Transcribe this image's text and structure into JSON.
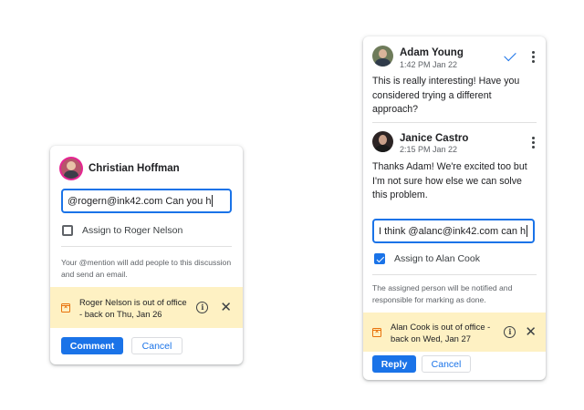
{
  "left_card": {
    "user_name": "Christian Hoffman",
    "input_value": "@rogern@ink42.com Can you h",
    "assign_label": "Assign to Roger Nelson",
    "assign_checked": false,
    "hint": "Your @mention will add people to this discussion and send an email.",
    "banner_text": "Roger Nelson is out of office - back on Thu, Jan 26",
    "primary_button": "Comment",
    "secondary_button": "Cancel",
    "banner_icon": "calendar-out-of-office-icon",
    "info_icon": "info-icon",
    "close_icon": "close-icon"
  },
  "right_card": {
    "comment1": {
      "author": "Adam Young",
      "time": "1:42 PM Jan 22",
      "text": "This is really interesting! Have you considered trying a different approach?"
    },
    "comment2": {
      "author": "Janice Castro",
      "time": "2:15 PM Jan 22",
      "text": "Thanks Adam! We're excited too but I'm not sure how else we can solve this problem."
    },
    "input_value": "I think @alanc@ink42.com can h",
    "assign_label": "Assign to Alan Cook",
    "assign_checked": true,
    "hint": "The assigned person will be notified and responsible for marking as done.",
    "banner_text": "Alan Cook is out of office - back on Wed, Jan 27",
    "primary_button": "Reply",
    "secondary_button": "Cancel",
    "resolve_icon": "checkmark-icon",
    "more_icon": "more-vert-icon"
  },
  "colors": {
    "accent": "#1a73e8",
    "banner_bg": "#fef1c3",
    "banner_icon": "#e8710a"
  }
}
